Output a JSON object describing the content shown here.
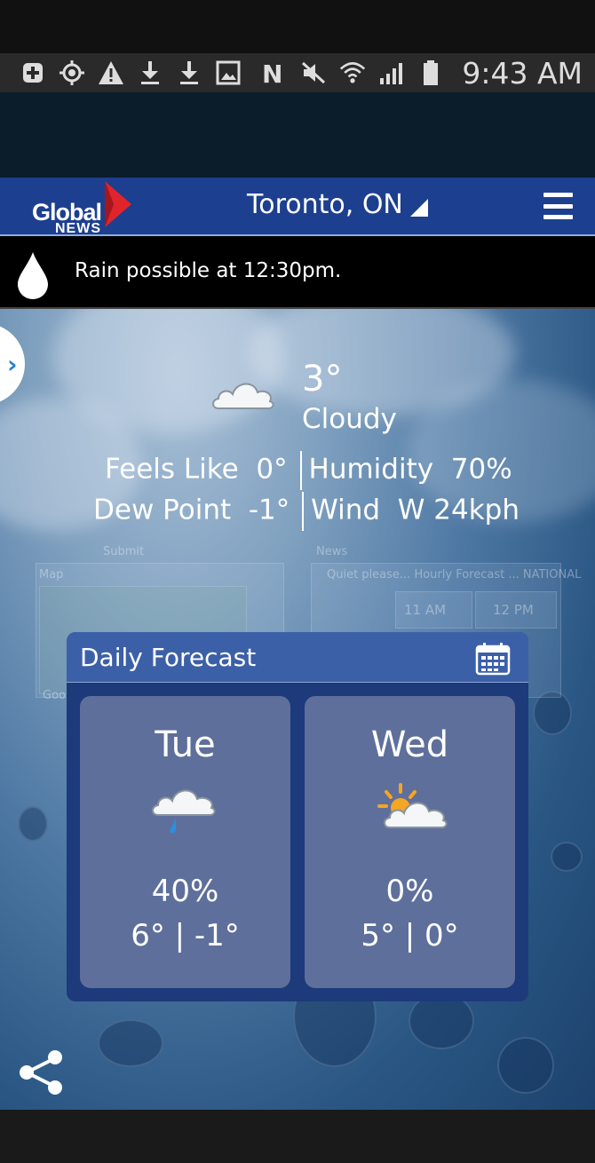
{
  "status_bar": {
    "time": "9:43 AM",
    "left_icons": [
      "add-box-icon",
      "gps-icon",
      "warning-icon",
      "download-icon",
      "download-icon",
      "image-icon"
    ],
    "right_icons": [
      "nfc-icon",
      "mute-icon",
      "wifi-icon",
      "signal-icon",
      "battery-icon"
    ]
  },
  "app_bar": {
    "logo_text": "Global",
    "logo_subtext": "NEWS",
    "location": "Toronto, ON",
    "menu_icon": "hamburger-menu-icon"
  },
  "alert": {
    "icon": "raindrop-icon",
    "text": "Rain possible at 12:30pm."
  },
  "current": {
    "icon": "cloud-icon",
    "temperature": "3°",
    "condition": "Cloudy",
    "feels_like_label": "Feels Like",
    "feels_like_value": "0°",
    "humidity_label": "Humidity",
    "humidity_value": "70%",
    "dew_point_label": "Dew Point",
    "dew_point_value": "-1°",
    "wind_label": "Wind",
    "wind_value": "W 24kph"
  },
  "background_panels": {
    "submit_label": "Submit",
    "news_label": "News",
    "map_label": "Map",
    "hourly_label": "Quiet please... Hourly Forecast ... NATIONAL",
    "hour_1": "11 AM",
    "hour_2": "12 PM",
    "map_credit": "Goo"
  },
  "daily_forecast": {
    "title": "Daily Forecast",
    "calendar_icon": "calendar-icon",
    "days": [
      {
        "day": "Tue",
        "icon": "cloud-rain-icon",
        "precip": "40%",
        "temps": "6° | -1°"
      },
      {
        "day": "Wed",
        "icon": "partly-sunny-icon",
        "precip": "0%",
        "temps": "5° | 0°"
      }
    ]
  },
  "share_icon": "share-icon",
  "colors": {
    "app_bar": "#1d3f8f",
    "forecast_panel": "#1d3a7a",
    "forecast_header": "#3c60a8",
    "day_card": "#5f6f9b",
    "logo_red": "#e0242b",
    "sun_orange": "#f5a623",
    "rain_blue": "#2b8fe0"
  }
}
